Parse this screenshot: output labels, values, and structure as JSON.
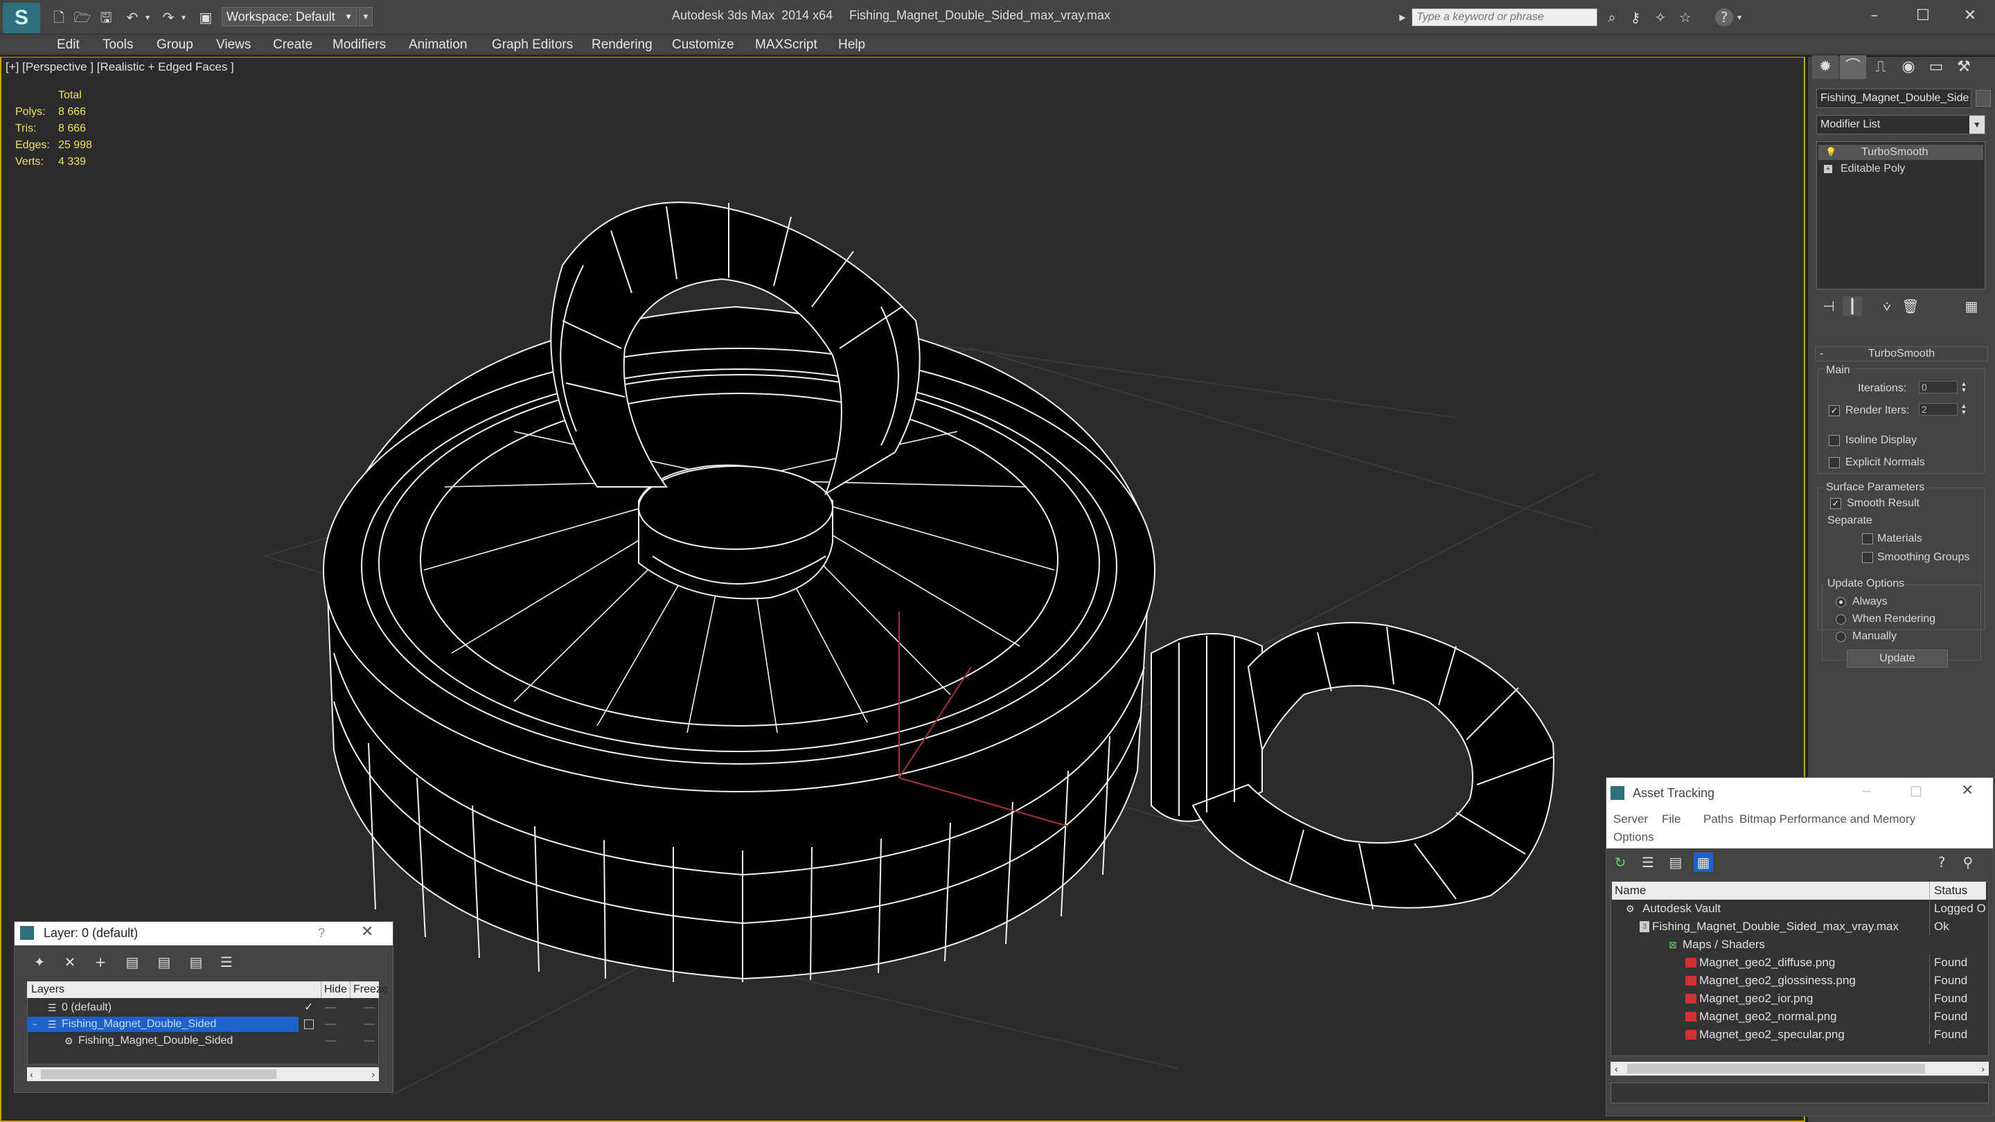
{
  "titlebar": {
    "workspace": "Workspace: Default",
    "app_title": "Autodesk 3ds Max  2014 x64",
    "file_title": "Fishing_Magnet_Double_Sided_max_vray.max",
    "search_placeholder": "Type a keyword or phrase"
  },
  "menu": [
    "Edit",
    "Tools",
    "Group",
    "Views",
    "Create",
    "Modifiers",
    "Animation",
    "Graph Editors",
    "Rendering",
    "Customize",
    "MAXScript",
    "Help"
  ],
  "viewport": {
    "label": "[+] [Perspective ] [Realistic + Edged Faces ]",
    "stats": {
      "total_label": "Total",
      "rows": [
        {
          "label": "Polys:",
          "value": "8 666"
        },
        {
          "label": "Tris:",
          "value": "8 666"
        },
        {
          "label": "Edges:",
          "value": "25 998"
        },
        {
          "label": "Verts:",
          "value": "4 339"
        }
      ]
    }
  },
  "command_panel": {
    "object_name": "Fishing_Magnet_Double_Side",
    "modifier_list": "Modifier List",
    "stack": [
      "TurboSmooth",
      "Editable Poly"
    ],
    "rollout_title": "TurboSmooth",
    "main_label": "Main",
    "iterations_label": "Iterations:",
    "iterations_value": "0",
    "render_iters_label": "Render Iters:",
    "render_iters_value": "2",
    "isoline_label": "Isoline Display",
    "explicit_normals_label": "Explicit Normals",
    "surface_params_label": "Surface Parameters",
    "smooth_result_label": "Smooth Result",
    "separate_label": "Separate",
    "materials_label": "Materials",
    "smoothing_groups_label": "Smoothing Groups",
    "update_options_label": "Update Options",
    "always_label": "Always",
    "when_rendering_label": "When Rendering",
    "manually_label": "Manually",
    "update_button": "Update"
  },
  "layer_window": {
    "title": "Layer: 0 (default)",
    "help": "?",
    "col_layers": "Layers",
    "col_hide": "Hide",
    "col_freeze": "Freeze",
    "rows": [
      {
        "name": "0 (default)"
      },
      {
        "name": "Fishing_Magnet_Double_Sided"
      },
      {
        "name": "Fishing_Magnet_Double_Sided"
      }
    ]
  },
  "asset_window": {
    "title": "Asset Tracking",
    "menu": [
      "Server",
      "File",
      "Paths",
      "Bitmap Performance and Memory",
      "Options"
    ],
    "col_name": "Name",
    "col_status": "Status",
    "rows": [
      {
        "name": "Autodesk Vault",
        "status": "Logged Ou"
      },
      {
        "name": "Fishing_Magnet_Double_Sided_max_vray.max",
        "status": "Ok"
      },
      {
        "name": "Maps / Shaders",
        "status": ""
      },
      {
        "name": "Magnet_geo2_diffuse.png",
        "status": "Found"
      },
      {
        "name": "Magnet_geo2_glossiness.png",
        "status": "Found"
      },
      {
        "name": "Magnet_geo2_ior.png",
        "status": "Found"
      },
      {
        "name": "Magnet_geo2_normal.png",
        "status": "Found"
      },
      {
        "name": "Magnet_geo2_specular.png",
        "status": "Found"
      }
    ]
  },
  "colors": {
    "accent": "#c8a400",
    "selection": "#1e62c8",
    "stats": "#f0e066"
  }
}
